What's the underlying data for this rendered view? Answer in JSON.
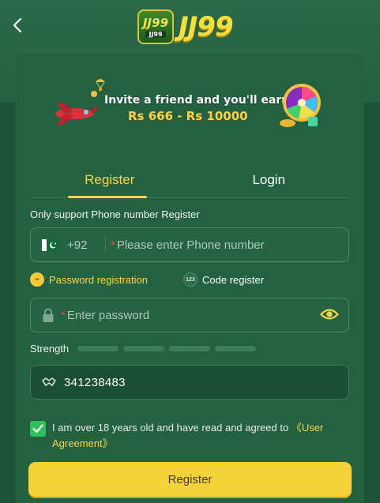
{
  "header": {
    "logo_badge_big": "JJ99",
    "logo_badge_small": "JJ99",
    "logo_text": "JJ99"
  },
  "banner": {
    "line1": "Invite a friend and you'll earn",
    "line2": "Rs 666 - Rs 10000"
  },
  "tabs": [
    {
      "label": "Register",
      "active": true
    },
    {
      "label": "Login",
      "active": false
    }
  ],
  "form": {
    "hint": "Only support Phone number Register",
    "phone": {
      "country_code": "+92",
      "required_mark": "*",
      "placeholder": "Please enter Phone number",
      "value": ""
    },
    "options": {
      "password_registration": "Password registration",
      "code_register": "Code register",
      "code_icon_text": "123"
    },
    "password": {
      "required_mark": "*",
      "placeholder": "Enter password",
      "value": ""
    },
    "strength_label": "Strength",
    "code": {
      "value": "341238483"
    },
    "agreement": {
      "checked": true,
      "text": "I am over 18 years old and have read and agreed to ",
      "link": "《User Agreement》"
    },
    "submit_label": "Register"
  },
  "colors": {
    "accent": "#f5d74a",
    "background": "#215c3f",
    "card": "#236140",
    "checkbox": "#2fc15a",
    "required": "#e24a3a"
  },
  "icons": {
    "back": "chevron-left-icon",
    "flag": "pakistan-flag-icon",
    "lock": "lock-icon",
    "eye": "eye-icon",
    "code": "handshake-icon",
    "check": "check-icon"
  }
}
